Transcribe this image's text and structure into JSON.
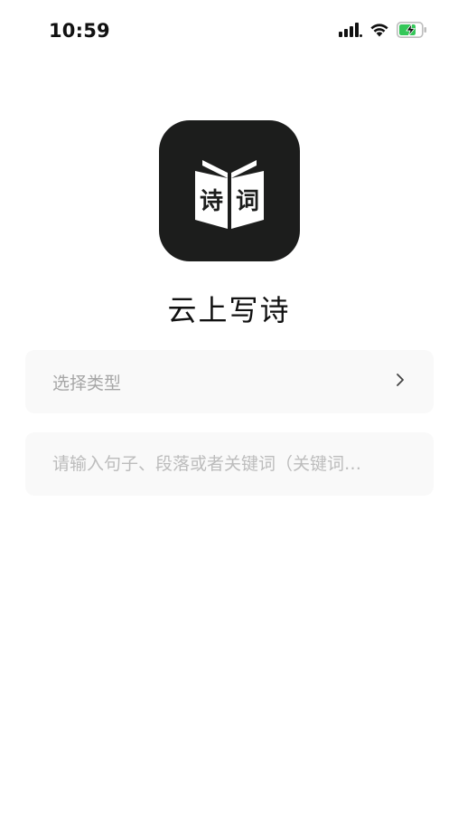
{
  "status_bar": {
    "time": "10:59",
    "icons": [
      "signal-icon",
      "wifi-icon",
      "battery-charging-icon"
    ],
    "battery_color": "#34c759"
  },
  "app": {
    "name": "云上写诗",
    "logo_left_char": "诗",
    "logo_right_char": "词",
    "logo_bg": "#1c1d1c"
  },
  "form": {
    "type_select_label": "选择类型",
    "input_placeholder": "请输入句子、段落或者关键词（关键词…",
    "input_value": ""
  }
}
